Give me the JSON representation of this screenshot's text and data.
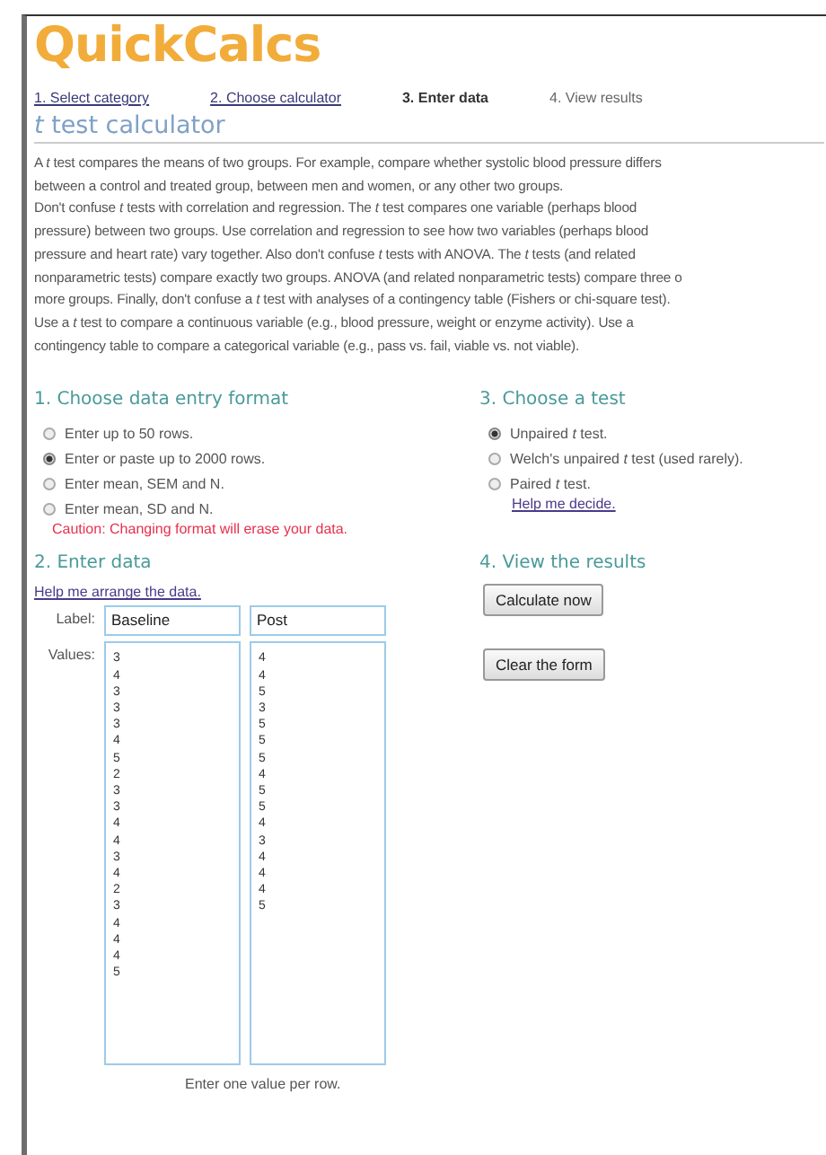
{
  "logo": "QuickCalcs",
  "steps": [
    {
      "label": "1. Select category",
      "selected": false,
      "link": true
    },
    {
      "label": "2. Choose calculator",
      "selected": false,
      "link": true
    },
    {
      "label": "3. Enter data",
      "selected": true,
      "link": false
    },
    {
      "label": "4. View results",
      "selected": false,
      "link": false
    }
  ],
  "title": "*t* test calculator",
  "intro": [
    "A *t*  test compares the means of two groups. For example, compare whether systolic blood pressure differs\nbetween a control and treated group, between men and women, or any other two groups.",
    "Don't confuse *t*  tests with correlation and regression. The *t* test compares one variable (perhaps blood\npressure) between two groups. Use correlation and regression to see how two variables (perhaps blood\npressure and heart rate) vary together. Also don't confuse *t*  tests with ANOVA. The *t*  tests (and related\nnonparametric tests) compare exactly two groups. ANOVA (and related nonparametric tests) compare three o\nmore groups. Finally, don't confuse a *t* test with analyses of a contingency table (Fishers or chi-square test).\nUse a *t*  test to compare a continuous variable (e.g., blood pressure, weight or enzyme activity). Use a\ncontingency table to compare a categorical variable (e.g., pass vs. fail, viable vs. not viable)."
  ],
  "format": {
    "heading": "1. Choose data entry format",
    "options": [
      {
        "label": "Enter up to 50 rows.",
        "selected": false
      },
      {
        "label": "Enter or paste up to 2000 rows.",
        "selected": true
      },
      {
        "label": "Enter mean, SEM and N.",
        "selected": false
      },
      {
        "label": "Enter mean, SD and N.",
        "selected": false
      }
    ],
    "caution": "Caution: Changing format will erase your data."
  },
  "test": {
    "heading": "3. Choose a test",
    "options": [
      {
        "label": "Unpaired *t* test.",
        "selected": true
      },
      {
        "label": "Welch's unpaired *t* test (used rarely).",
        "selected": false
      },
      {
        "label": "Paired *t* test.",
        "selected": false
      }
    ],
    "help": "Help me decide."
  },
  "data": {
    "heading": "2. Enter data",
    "help": "Help me arrange the data.",
    "label_caption": "Label:",
    "values_caption": "Values:",
    "columns": [
      {
        "label": "Baseline",
        "values": [
          "3",
          "4",
          "3",
          "3",
          "3",
          "4",
          "5",
          "2",
          "3",
          "3",
          "4",
          "4",
          "3",
          "4",
          "2",
          "3",
          "4",
          "4",
          "4",
          "5"
        ]
      },
      {
        "label": "Post",
        "values": [
          "4",
          "4",
          "5",
          "3",
          "5",
          "5",
          "5",
          "4",
          "5",
          "5",
          "4",
          "3",
          "4",
          "4",
          "4",
          "5"
        ]
      }
    ],
    "hint": "Enter one value per row."
  },
  "results": {
    "heading": "4. View the results",
    "buttons": [
      "Calculate now",
      "Clear the form"
    ]
  }
}
